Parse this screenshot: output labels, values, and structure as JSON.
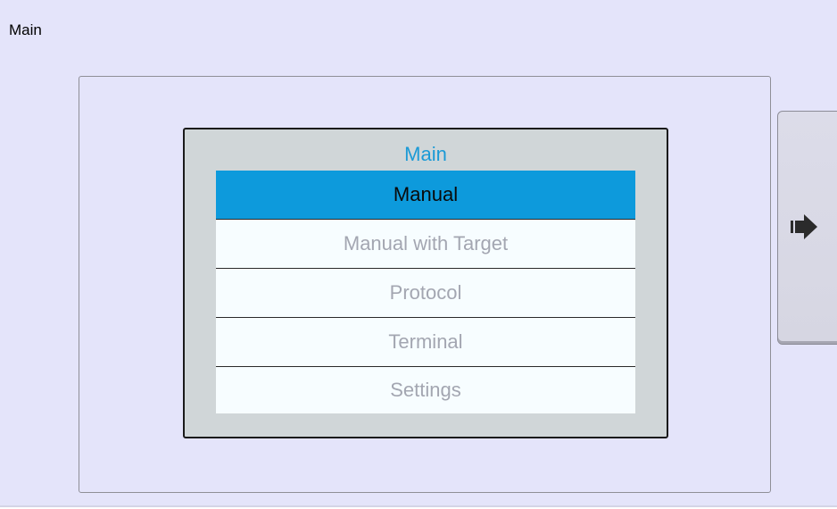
{
  "window": {
    "title": "Main"
  },
  "panel": {
    "title": "Main",
    "menu": [
      {
        "label": "Manual",
        "selected": true
      },
      {
        "label": "Manual with Target",
        "selected": false
      },
      {
        "label": "Protocol",
        "selected": false
      },
      {
        "label": "Terminal",
        "selected": false
      },
      {
        "label": "Settings",
        "selected": false
      }
    ]
  },
  "nav": {
    "next_icon": "arrow-right-icon"
  },
  "colors": {
    "background": "#e4e4fa",
    "panel": "#d0d6d8",
    "accent": "#0d9adc",
    "title": "#1b9ad6",
    "item_text_inactive": "#a3a6b1",
    "item_background": "#f7fdff"
  }
}
